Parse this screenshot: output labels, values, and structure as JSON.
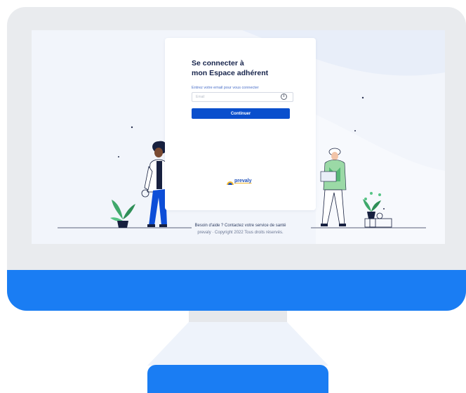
{
  "login": {
    "title_line1": "Se connecter à",
    "title_line2": "mon Espace adhérent",
    "email_label": "Entrez votre email pour vous connecter",
    "email_placeholder": "Email",
    "email_value": "",
    "continue_label": "Continuer"
  },
  "brand": {
    "name": "prevaly"
  },
  "footer": {
    "help": "Besoin d'aide ? Contactez votre service de santé",
    "copyright": "prevaly · Copyright 2022 Tous droits réservés."
  },
  "icons": {
    "info": "info-icon",
    "logo": "prevaly-logo"
  },
  "colors": {
    "primary_button": "#0a4fcd",
    "monitor_accent": "#1a7df3",
    "title_text": "#16234b",
    "screen_background": "#f2f5fb"
  }
}
